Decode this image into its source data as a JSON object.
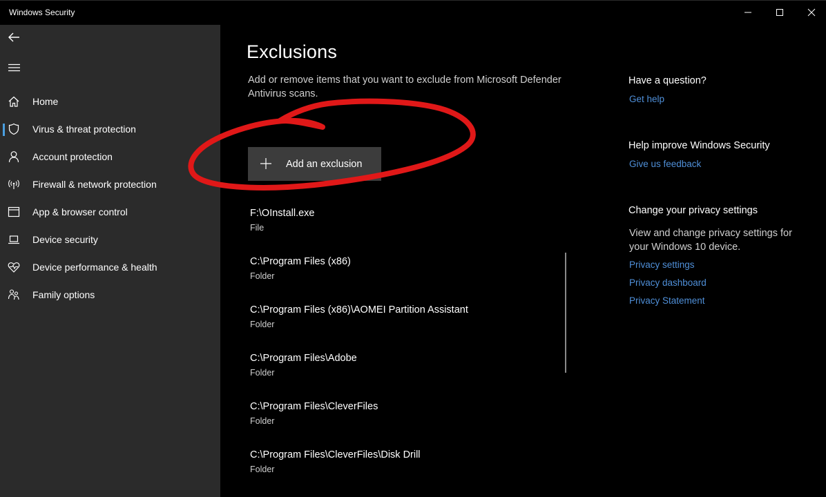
{
  "window": {
    "title": "Windows Security"
  },
  "sidebar": {
    "items": [
      {
        "label": "Home",
        "icon": "home-icon"
      },
      {
        "label": "Virus & threat protection",
        "icon": "shield-icon"
      },
      {
        "label": "Account protection",
        "icon": "person-icon"
      },
      {
        "label": "Firewall & network protection",
        "icon": "wifi-antenna-icon"
      },
      {
        "label": "App & browser control",
        "icon": "app-window-icon"
      },
      {
        "label": "Device security",
        "icon": "laptop-icon"
      },
      {
        "label": "Device performance & health",
        "icon": "heart-pulse-icon"
      },
      {
        "label": "Family options",
        "icon": "family-icon"
      }
    ],
    "selected": "Virus & threat protection"
  },
  "main": {
    "title": "Exclusions",
    "description": "Add or remove items that you want to exclude from Microsoft Defender Antivirus scans.",
    "add_button_label": "Add an exclusion",
    "exclusions": [
      {
        "path": "F:\\OInstall.exe",
        "type": "File"
      },
      {
        "path": "C:\\Program Files (x86)",
        "type": "Folder"
      },
      {
        "path": "C:\\Program Files (x86)\\AOMEI Partition Assistant",
        "type": "Folder"
      },
      {
        "path": "C:\\Program Files\\Adobe",
        "type": "Folder"
      },
      {
        "path": "C:\\Program Files\\CleverFiles",
        "type": "Folder"
      },
      {
        "path": "C:\\Program Files\\CleverFiles\\Disk Drill",
        "type": "Folder"
      }
    ]
  },
  "right_panel": {
    "question_heading": "Have a question?",
    "get_help_link": "Get help",
    "improve_heading": "Help improve Windows Security",
    "feedback_link": "Give us feedback",
    "privacy_heading": "Change your privacy settings",
    "privacy_text": "View and change privacy settings for your Windows 10 device.",
    "privacy_settings_link": "Privacy settings",
    "privacy_dashboard_link": "Privacy dashboard",
    "privacy_statement_link": "Privacy Statement"
  },
  "colors": {
    "accent": "#4a9fe0",
    "link": "#4f8fd8",
    "annotation": "#e01818",
    "sidebar_bg": "#2b2b2b",
    "main_bg": "#000000"
  }
}
